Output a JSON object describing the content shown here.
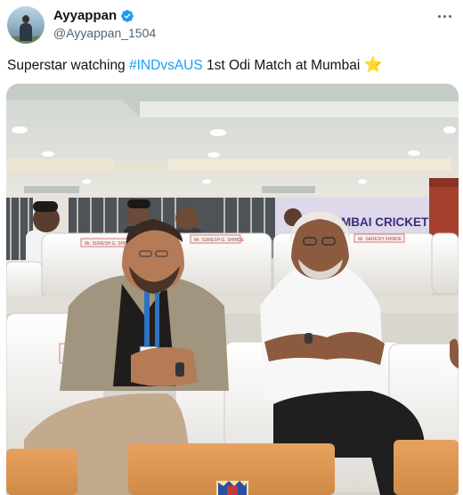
{
  "author": {
    "display_name": "Ayyappan",
    "handle": "@Ayyappan_1504",
    "verified_icon": "verified-badge-icon",
    "avatar_icon": "avatar"
  },
  "tweet": {
    "text_before": "Superstar watching ",
    "hashtag": "#INDvsAUS",
    "text_after": " 1st Odi Match at Mumbai ",
    "emoji": "⭐"
  },
  "media": {
    "banner_text": "MUMBAI CRICKET A",
    "seat_labels": [
      "Mr. SURESH G. SHINDE",
      "Mr. SURESH G. SHINDE",
      "Mr. SARESH SHINDE"
    ]
  },
  "colors": {
    "hashtag": "#1d9bf0",
    "verified": "#1d9bf0",
    "banner": "#3d2b7a"
  }
}
